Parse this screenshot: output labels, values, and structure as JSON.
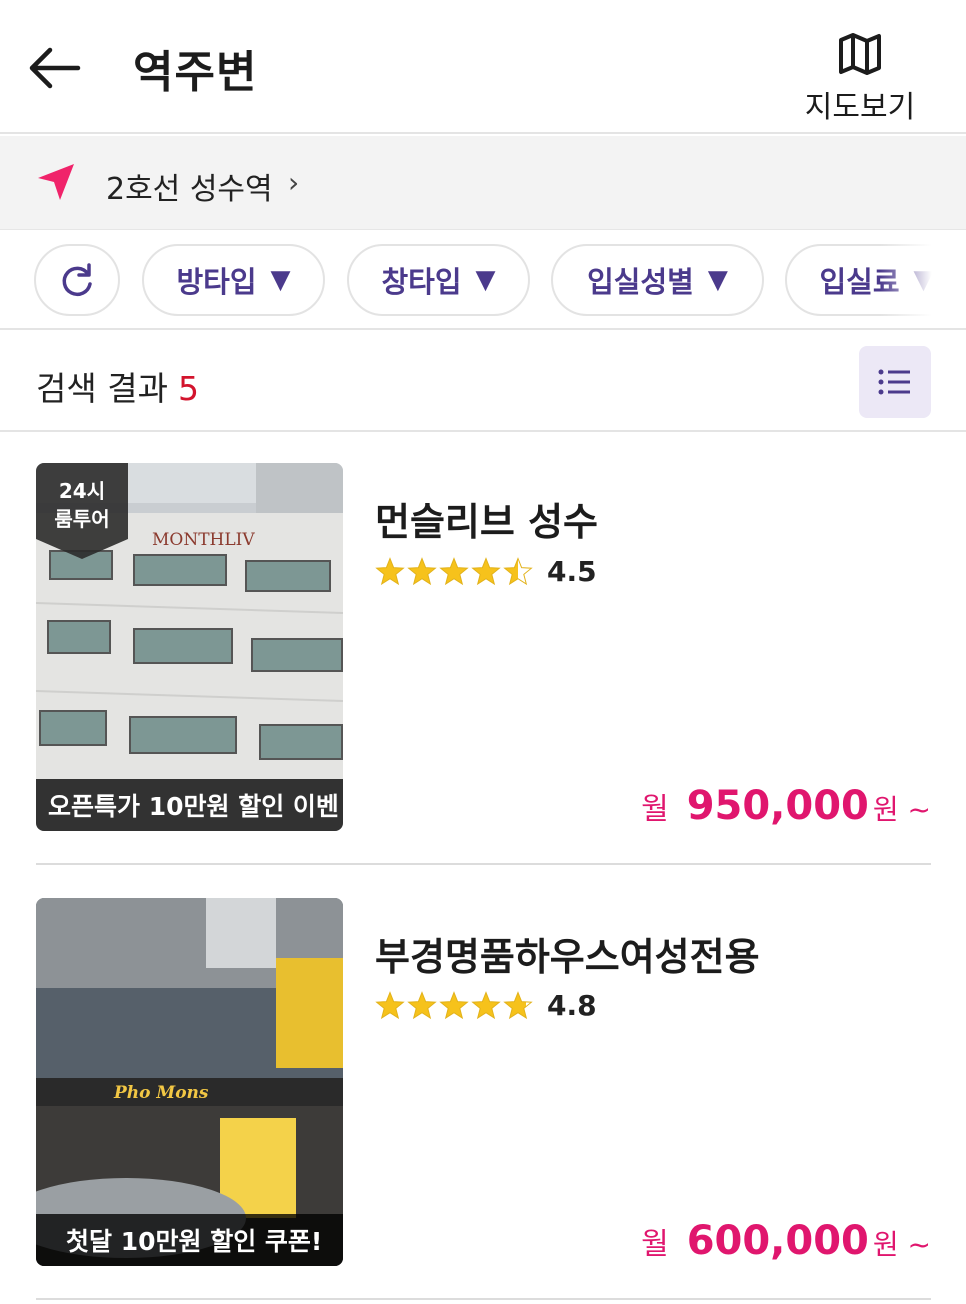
{
  "header": {
    "title": "역주변",
    "map_label": "지도보기"
  },
  "location": {
    "text": "2호선 성수역",
    "chevron": "›"
  },
  "filters": [
    {
      "label": "방타입",
      "caret": "▼"
    },
    {
      "label": "창타입",
      "caret": "▼"
    },
    {
      "label": "입실성별",
      "caret": "▼"
    },
    {
      "label": "입실료",
      "caret": "▼"
    }
  ],
  "results": {
    "label": "검색 결과",
    "count": "5"
  },
  "listings": [
    {
      "name": "먼슬리브 성수",
      "rating": "4.5",
      "rating_value": 4.5,
      "badge": [
        "24시",
        "룸투어"
      ],
      "caption": "오픈특가 10만원 할인 이벤",
      "sign_text": "MONTHLIV",
      "price_prefix": "월",
      "price": "950,000",
      "price_suffix": "원 ~"
    },
    {
      "name": "부경명품하우스여성전용",
      "rating": "4.8",
      "rating_value": 4.8,
      "caption": "첫달 10만원 할인 쿠폰!",
      "sign_text": "Pho Mons",
      "price_prefix": "월",
      "price": "600,000",
      "price_suffix": "원 ~"
    }
  ],
  "icons": {
    "back": "back-arrow-icon",
    "map": "map-icon",
    "location": "location-arrow-icon",
    "refresh": "refresh-icon",
    "list": "list-icon",
    "star": "star-icon"
  },
  "colors": {
    "accent_purple": "#4b3a8c",
    "price_pink": "#e0166e",
    "count_red": "#d3142d",
    "star_yellow": "#f6c21b",
    "location_pink": "#f0236a"
  }
}
